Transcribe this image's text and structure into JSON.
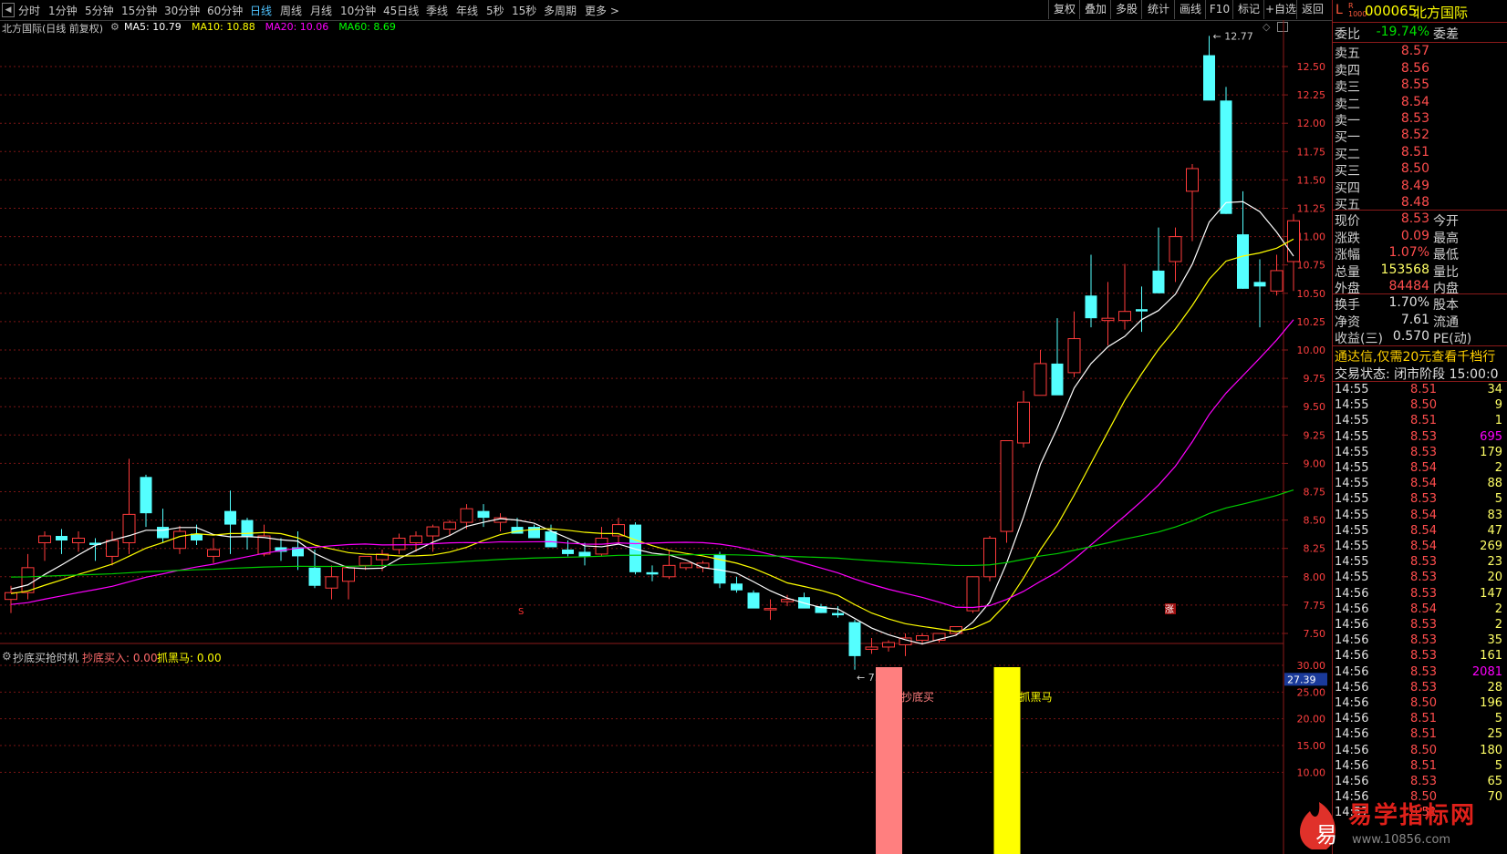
{
  "toolbar": {
    "periods": [
      "分时",
      "1分钟",
      "5分钟",
      "15分钟",
      "30分钟",
      "60分钟",
      "日线",
      "周线",
      "月线",
      "10分钟",
      "45日线",
      "季线",
      "年线",
      "5秒",
      "15秒",
      "多周期",
      "更多 >"
    ],
    "active": "日线",
    "right_buttons": [
      "复权",
      "叠加",
      "多股",
      "统计",
      "画线",
      "F10",
      "标记",
      "+自选",
      "返回"
    ]
  },
  "chart_title": "北方国际(日线 前复权)",
  "ma_legend": [
    {
      "label": "MA5: 10.79",
      "color": "#ffffff"
    },
    {
      "label": "MA10: 10.88",
      "color": "#ffff00"
    },
    {
      "label": "MA20: 10.06",
      "color": "#ff00ff"
    },
    {
      "label": "MA60: 8.69",
      "color": "#00ff00"
    }
  ],
  "price_axis": [
    "12.50",
    "12.25",
    "12.00",
    "11.75",
    "11.50",
    "11.25",
    "11.00",
    "10.75",
    "10.50",
    "10.25",
    "10.00",
    "9.75",
    "9.50",
    "9.25",
    "9.00",
    "8.75",
    "8.50",
    "8.25",
    "8.00",
    "7.75",
    "7.50"
  ],
  "high_label": "12.77",
  "low_label": "7.18",
  "marker_s": "S",
  "marker_zhang": "涨",
  "colors": {
    "up": "#ff3b3b",
    "down": "#54ffff",
    "ma5": "#ffffff",
    "ma10": "#ffff00",
    "ma20": "#ff00ff",
    "ma60": "#00cc00",
    "grid": "#7a1515"
  },
  "chart_data": {
    "type": "candlestick",
    "candles": [
      [
        7.8,
        7.92,
        7.68,
        7.86
      ],
      [
        7.86,
        8.2,
        7.8,
        8.08
      ],
      [
        8.3,
        8.4,
        8.14,
        8.36
      ],
      [
        8.36,
        8.42,
        8.2,
        8.32
      ],
      [
        8.3,
        8.4,
        8.22,
        8.34
      ],
      [
        8.3,
        8.34,
        8.14,
        8.28
      ],
      [
        8.18,
        8.4,
        8.1,
        8.32
      ],
      [
        8.3,
        9.04,
        8.2,
        8.55
      ],
      [
        8.88,
        8.9,
        8.44,
        8.56
      ],
      [
        8.44,
        8.6,
        8.3,
        8.34
      ],
      [
        8.25,
        8.45,
        8.2,
        8.4
      ],
      [
        8.38,
        8.46,
        8.28,
        8.32
      ],
      [
        8.18,
        8.34,
        8.12,
        8.24
      ],
      [
        8.58,
        8.76,
        8.2,
        8.46
      ],
      [
        8.5,
        8.52,
        8.24,
        8.35
      ],
      [
        8.2,
        8.46,
        8.18,
        8.36
      ],
      [
        8.26,
        8.34,
        8.14,
        8.22
      ],
      [
        8.26,
        8.4,
        8.06,
        8.18
      ],
      [
        8.08,
        8.24,
        7.9,
        7.92
      ],
      [
        7.9,
        8.1,
        7.8,
        8.0
      ],
      [
        7.96,
        8.06,
        7.8,
        8.08
      ],
      [
        8.1,
        8.16,
        8.06,
        8.18
      ],
      [
        8.15,
        8.24,
        8.05,
        8.2
      ],
      [
        8.24,
        8.38,
        8.2,
        8.34
      ],
      [
        8.3,
        8.4,
        8.22,
        8.36
      ],
      [
        8.36,
        8.46,
        8.22,
        8.44
      ],
      [
        8.42,
        8.5,
        8.36,
        8.48
      ],
      [
        8.48,
        8.64,
        8.42,
        8.6
      ],
      [
        8.58,
        8.64,
        8.44,
        8.52
      ],
      [
        8.48,
        8.56,
        8.4,
        8.52
      ],
      [
        8.44,
        8.52,
        8.4,
        8.38
      ],
      [
        8.44,
        8.46,
        8.36,
        8.34
      ],
      [
        8.4,
        8.46,
        8.28,
        8.26
      ],
      [
        8.24,
        8.32,
        8.18,
        8.2
      ],
      [
        8.22,
        8.3,
        8.1,
        8.18
      ],
      [
        8.2,
        8.44,
        8.18,
        8.34
      ],
      [
        8.36,
        8.52,
        8.3,
        8.46
      ],
      [
        8.46,
        8.48,
        8.02,
        8.04
      ],
      [
        8.04,
        8.1,
        7.96,
        8.02
      ],
      [
        8.0,
        8.24,
        7.98,
        8.1
      ],
      [
        8.08,
        8.12,
        8.06,
        8.12
      ],
      [
        8.08,
        8.14,
        8.04,
        8.12
      ],
      [
        8.2,
        8.22,
        7.9,
        7.94
      ],
      [
        7.94,
        8.0,
        7.86,
        7.88
      ],
      [
        7.86,
        7.88,
        7.74,
        7.72
      ],
      [
        7.72,
        7.8,
        7.62,
        7.72
      ],
      [
        7.78,
        7.84,
        7.74,
        7.8
      ],
      [
        7.82,
        7.86,
        7.74,
        7.72
      ],
      [
        7.74,
        7.76,
        7.68,
        7.68
      ],
      [
        7.68,
        7.74,
        7.64,
        7.66
      ],
      [
        7.6,
        7.62,
        7.18,
        7.3
      ],
      [
        7.36,
        7.46,
        7.32,
        7.38
      ],
      [
        7.38,
        7.44,
        7.34,
        7.42
      ],
      [
        7.4,
        7.5,
        7.3,
        7.46
      ],
      [
        7.44,
        7.5,
        7.4,
        7.48
      ],
      [
        7.44,
        7.5,
        7.42,
        7.5
      ],
      [
        7.5,
        7.54,
        7.48,
        7.56
      ],
      [
        7.7,
        8.0,
        7.68,
        8.0
      ],
      [
        8.0,
        8.36,
        7.96,
        8.34
      ],
      [
        8.4,
        9.2,
        8.3,
        9.2
      ],
      [
        9.18,
        9.64,
        9.14,
        9.54
      ],
      [
        9.6,
        10.0,
        9.6,
        9.88
      ],
      [
        9.88,
        10.28,
        9.78,
        9.6
      ],
      [
        9.8,
        10.34,
        9.76,
        10.1
      ],
      [
        10.48,
        10.84,
        10.2,
        10.28
      ],
      [
        10.26,
        10.6,
        10.04,
        10.28
      ],
      [
        10.26,
        10.76,
        10.18,
        10.34
      ],
      [
        10.36,
        10.56,
        10.16,
        10.34
      ],
      [
        10.7,
        11.08,
        10.5,
        10.5
      ],
      [
        10.78,
        11.08,
        10.6,
        11.0
      ],
      [
        11.4,
        11.64,
        10.96,
        11.6
      ],
      [
        12.6,
        12.77,
        12.4,
        12.2
      ],
      [
        12.2,
        12.32,
        11.2,
        11.2
      ],
      [
        11.02,
        11.4,
        10.54,
        10.54
      ],
      [
        10.6,
        10.8,
        10.2,
        10.56
      ],
      [
        10.52,
        10.84,
        10.48,
        10.7
      ],
      [
        10.78,
        11.2,
        10.52,
        11.14
      ]
    ],
    "ma5_last": 10.79,
    "ma10_last": 10.88,
    "ma20_last": 10.06,
    "ma60_last": 8.69,
    "y_range": [
      7.18,
      12.77
    ]
  },
  "sub_indicator": {
    "name": "抄底买抢时机",
    "items": [
      {
        "label": "抄底买入: 0.00",
        "color": "#ff6b6b"
      },
      {
        "label": "抓黑马: 0.00",
        "color": "#ffff00"
      }
    ],
    "axis": [
      "30.00",
      "25.00",
      "20.00",
      "15.00",
      "10.00"
    ],
    "current": "27.39",
    "bars": [
      {
        "label": "抄底买",
        "color": "#ff7f7f",
        "candle_index": 52
      },
      {
        "label": "抓黑马",
        "color": "#ffff00",
        "candle_index": 59
      }
    ]
  },
  "quote": {
    "code": "000065",
    "name": "北方国际",
    "weibi_label": "委比",
    "weibi": "-19.74%",
    "weicha_label": "委差",
    "sell": [
      {
        "l": "卖五",
        "p": "8.57"
      },
      {
        "l": "卖四",
        "p": "8.56"
      },
      {
        "l": "卖三",
        "p": "8.55"
      },
      {
        "l": "卖二",
        "p": "8.54"
      },
      {
        "l": "卖一",
        "p": "8.53"
      }
    ],
    "buy": [
      {
        "l": "买一",
        "p": "8.52"
      },
      {
        "l": "买二",
        "p": "8.51"
      },
      {
        "l": "买三",
        "p": "8.50"
      },
      {
        "l": "买四",
        "p": "8.49"
      },
      {
        "l": "买五",
        "p": "8.48"
      }
    ],
    "stats": [
      {
        "l": "现价",
        "v": "8.53",
        "r": "今开",
        "c": "#ff4d4d"
      },
      {
        "l": "涨跌",
        "v": "0.09",
        "r": "最高",
        "c": "#ff4d4d"
      },
      {
        "l": "涨幅",
        "v": "1.07%",
        "r": "最低",
        "c": "#ff4d4d"
      },
      {
        "l": "总量",
        "v": "153568",
        "r": "量比",
        "c": "#ffff66"
      },
      {
        "l": "外盘",
        "v": "84484",
        "r": "内盘",
        "c": "#ff4d4d"
      }
    ],
    "stats2": [
      {
        "l": "换手",
        "v": "1.70%",
        "r": "股本"
      },
      {
        "l": "净资",
        "v": "7.61",
        "r": "流通"
      },
      {
        "l": "收益(三)",
        "v": "0.570",
        "r": "PE(动)"
      }
    ],
    "notice": "通达信,仅需20元查看千档行",
    "status": "交易状态: 闭市阶段 15:00:0",
    "ticks": [
      [
        "14:55",
        "8.51",
        "34"
      ],
      [
        "14:55",
        "8.50",
        "9"
      ],
      [
        "14:55",
        "8.51",
        "1"
      ],
      [
        "14:55",
        "8.53",
        "695"
      ],
      [
        "14:55",
        "8.53",
        "179"
      ],
      [
        "14:55",
        "8.54",
        "2"
      ],
      [
        "14:55",
        "8.54",
        "88"
      ],
      [
        "14:55",
        "8.53",
        "5"
      ],
      [
        "14:55",
        "8.54",
        "83"
      ],
      [
        "14:55",
        "8.54",
        "47"
      ],
      [
        "14:55",
        "8.54",
        "269"
      ],
      [
        "14:55",
        "8.53",
        "23"
      ],
      [
        "14:55",
        "8.53",
        "20"
      ],
      [
        "14:56",
        "8.53",
        "147"
      ],
      [
        "14:56",
        "8.54",
        "2"
      ],
      [
        "14:56",
        "8.53",
        "2"
      ],
      [
        "14:56",
        "8.53",
        "35"
      ],
      [
        "14:56",
        "8.53",
        "161"
      ],
      [
        "14:56",
        "8.53",
        "2081"
      ],
      [
        "14:56",
        "8.53",
        "28"
      ],
      [
        "14:56",
        "8.50",
        "196"
      ],
      [
        "14:56",
        "8.51",
        "5"
      ],
      [
        "14:56",
        "8.51",
        "25"
      ],
      [
        "14:56",
        "8.50",
        "180"
      ],
      [
        "14:56",
        "8.51",
        "5"
      ],
      [
        "14:56",
        "8.53",
        "65"
      ],
      [
        "14:56",
        "8.50",
        "70"
      ],
      [
        "14:57",
        "8.51",
        ""
      ]
    ]
  },
  "watermark": {
    "char": "易",
    "text": "易学指标网",
    "url": "www.10856.com"
  }
}
